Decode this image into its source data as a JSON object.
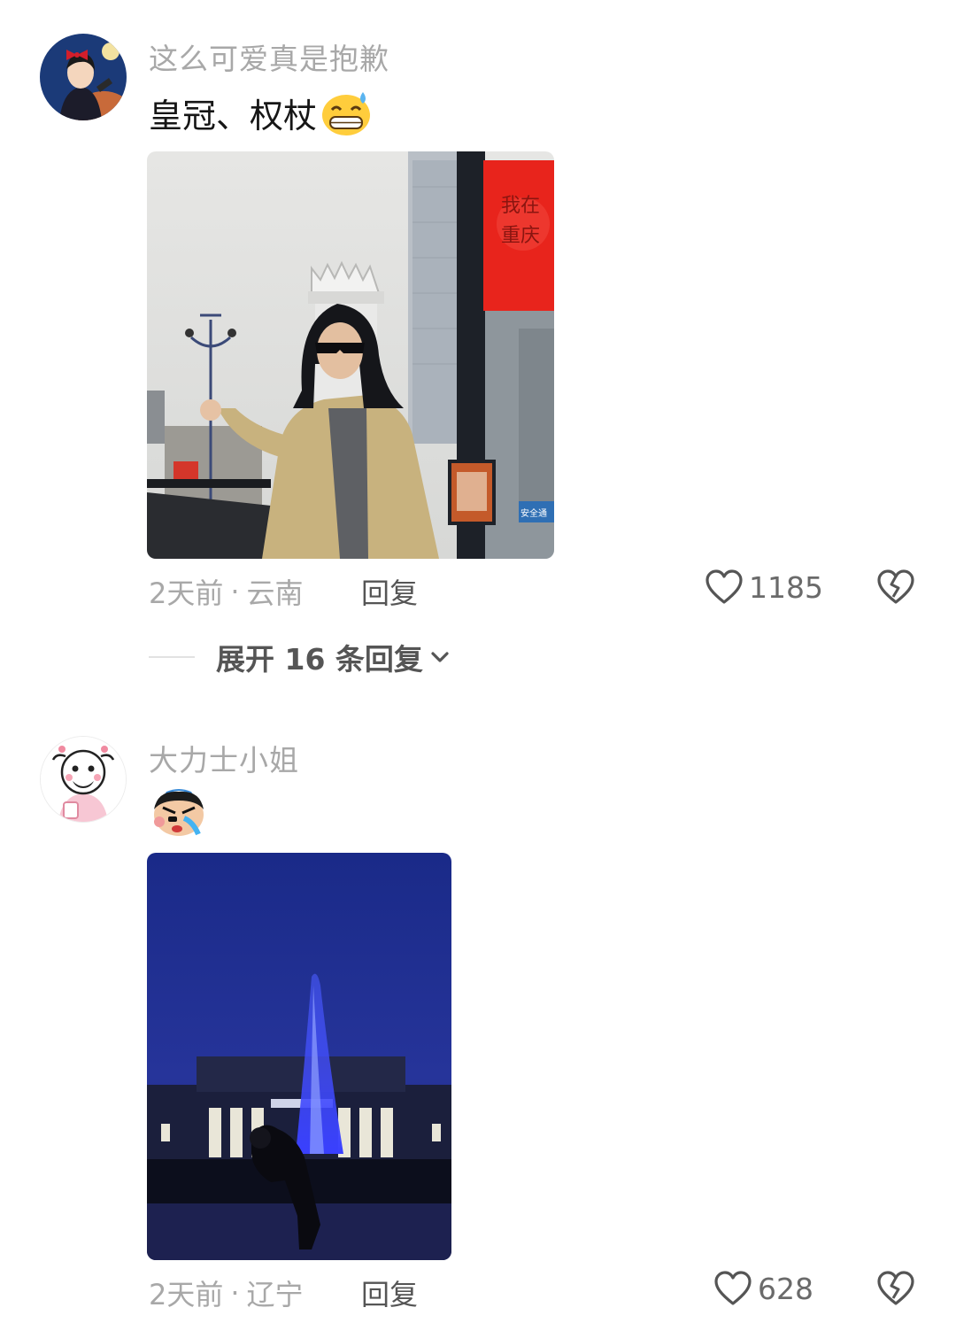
{
  "comments": [
    {
      "username": "这么可爱真是抱歉",
      "text": "皇冠、权杖",
      "time": "2天前",
      "location": "云南",
      "separator": "·",
      "reply_label": "回复",
      "likes": "1185",
      "expand_label": "展开 16 条回复",
      "photo_sign_text_1": "我在",
      "photo_sign_text_2": "重庆",
      "photo_sign_text_3": "安全通"
    },
    {
      "username": "大力士小姐",
      "time": "2天前",
      "location": "辽宁",
      "separator": "·",
      "reply_label": "回复",
      "likes": "628"
    }
  ],
  "icons": {
    "like": "heart-outline-icon",
    "dislike": "broken-heart-icon",
    "expand": "chevron-down-icon"
  },
  "colors": {
    "meta_gray": "#a8a8a8",
    "sign_red": "#e8241c",
    "night_blue": "#1f2d8a"
  }
}
